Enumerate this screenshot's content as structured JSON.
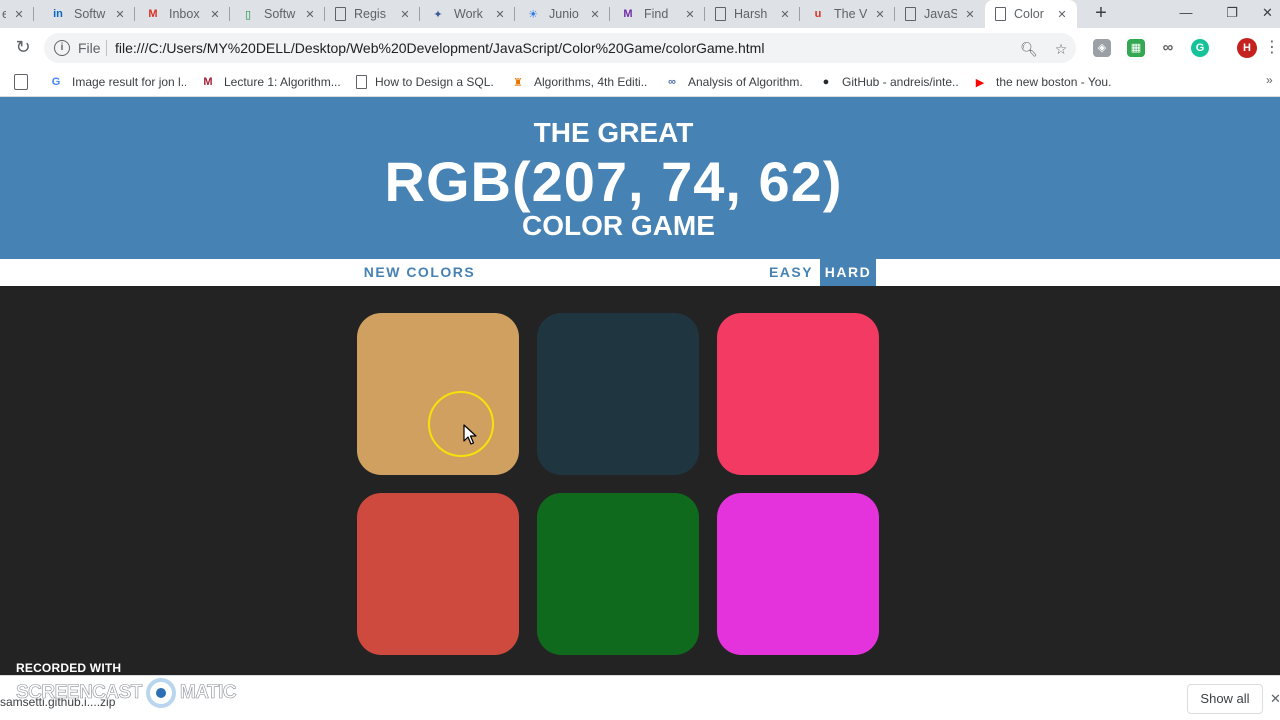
{
  "browser": {
    "tabs": [
      {
        "title": "e",
        "icon": "page-icon",
        "color": "#5f6368",
        "glyph": ""
      },
      {
        "title": "Softw",
        "icon": "linkedin-icon",
        "color": "#0a66c2",
        "glyph": "in"
      },
      {
        "title": "Inbox",
        "icon": "gmail-icon",
        "color": "#d93025",
        "glyph": "M"
      },
      {
        "title": "Softw",
        "icon": "green-doc-icon",
        "color": "#1e8e3e",
        "glyph": "▯"
      },
      {
        "title": "Regis",
        "icon": "page-icon",
        "color": "#5f6368",
        "glyph": ""
      },
      {
        "title": "Work",
        "icon": "app-icon",
        "color": "#3b5998",
        "glyph": "✦"
      },
      {
        "title": "Junio",
        "icon": "bulb-icon",
        "color": "#1a73e8",
        "glyph": "☀"
      },
      {
        "title": "Find",
        "icon": "m-logo-icon",
        "color": "#6f2da8",
        "glyph": "M"
      },
      {
        "title": "Harsh",
        "icon": "page-icon",
        "color": "#5f6368",
        "glyph": ""
      },
      {
        "title": "The V",
        "icon": "u-logo-icon",
        "color": "#d93025",
        "glyph": "u"
      },
      {
        "title": "JavaS",
        "icon": "page-icon",
        "color": "#5f6368",
        "glyph": ""
      },
      {
        "title": "Color",
        "icon": "page-icon",
        "color": "#5f6368",
        "glyph": "",
        "active": true
      }
    ],
    "new_tab": "+",
    "window": {
      "minimize": "—",
      "restore": "❐",
      "close": "✕"
    },
    "scheme": "File",
    "url": "file:///C:/Users/MY%20DELL/Desktop/Web%20Development/JavaScript/Color%20Game/colorGame.html",
    "profile_initial": "H",
    "bookmarks": [
      {
        "label": "Image result for jon l...",
        "icon": "google-icon",
        "color": "#4285f4",
        "glyph": "G"
      },
      {
        "label": "Lecture 1: Algorithm...",
        "icon": "mit-icon",
        "color": "#a31f34",
        "glyph": "M"
      },
      {
        "label": "How to Design a SQL...",
        "icon": "page-icon",
        "color": "#5f6368",
        "glyph": ""
      },
      {
        "label": "Algorithms, 4th Editi...",
        "icon": "princeton-shield-icon",
        "color": "#e77500",
        "glyph": "♜"
      },
      {
        "label": "Analysis of Algorithm...",
        "icon": "infinity-icon",
        "color": "#4a6fa5",
        "glyph": "∞"
      },
      {
        "label": "GitHub - andreis/inte...",
        "icon": "github-icon",
        "color": "#24292e",
        "glyph": "●"
      },
      {
        "label": "the new boston - You...",
        "icon": "youtube-icon",
        "color": "#ff0000",
        "glyph": "▶"
      }
    ]
  },
  "game": {
    "title_top": "The Great",
    "color_display": "RGB(207, 74, 62)",
    "title_bottom": "Color Game",
    "new_colors_label": "New Colors",
    "easy_label": "Easy",
    "hard_label": "Hard",
    "selected_mode": "Hard",
    "header_color": "#4682b4",
    "squares": [
      {
        "color": "#cfa060"
      },
      {
        "color": "#1f3640"
      },
      {
        "color": "#f23a63"
      },
      {
        "color": "#cf4a3e"
      },
      {
        "color": "#106a1e"
      },
      {
        "color": "#e432dc"
      }
    ]
  },
  "footer": {
    "download_file": "samsetti.github.i....zip",
    "show_all_label": "Show all",
    "close": "✕"
  },
  "watermark": {
    "recorded_with": "RECORDED WITH",
    "brand_left": "SCREENCAST",
    "brand_right": "MATIC"
  }
}
